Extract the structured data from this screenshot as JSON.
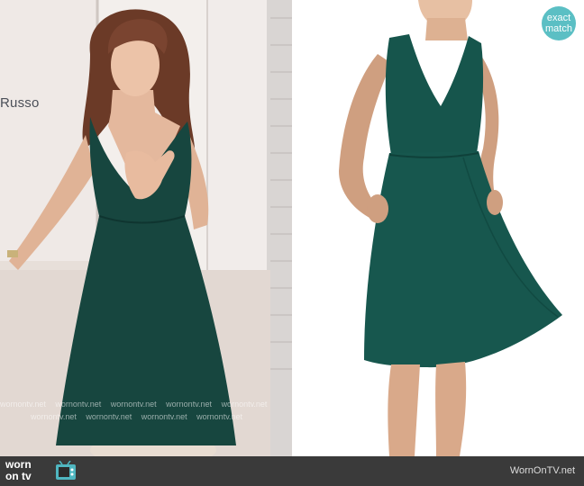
{
  "scene": {
    "wall_sign": "Russo"
  },
  "product": {
    "badge_line1": "exact",
    "badge_line2": "match",
    "badge_icon": "exact-match-badge"
  },
  "watermark": {
    "text": "wornontv.net"
  },
  "footer": {
    "logo_line1": "worn",
    "logo_line2": "on tv",
    "logo_icon": "tv-icon",
    "credit": "WornOnTV.net"
  },
  "colors": {
    "dress": "#17463f",
    "badge": "#5bbfc4",
    "bar": "#3a3a3a"
  }
}
